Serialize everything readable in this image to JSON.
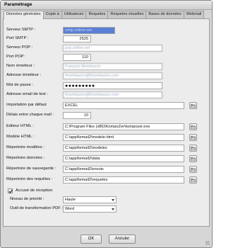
{
  "window": {
    "title": "Paramétrage"
  },
  "tabs": [
    {
      "label": "Données générales",
      "active": true
    },
    {
      "label": "Copie à"
    },
    {
      "label": "Utilisateurs"
    },
    {
      "label": "Requetes"
    },
    {
      "label": "Requetes visuelles"
    },
    {
      "label": "Bases de données"
    },
    {
      "label": "Webmail"
    }
  ],
  "form": {
    "serveur_smtp": {
      "label": "Serveur SMTP :",
      "value": "smtp.online.net"
    },
    "port_smtp": {
      "label": "Port SMTP :",
      "value": "2525"
    },
    "serveur_pop": {
      "label": "Serveur POP :",
      "value": "pop.online.net"
    },
    "port_pop": {
      "label": "Port POP :",
      "value": "110"
    },
    "nom_emetteur": {
      "label": "Nom émetteur :",
      "value": "François Mombazon"
    },
    "adresse_emetteur": {
      "label": "Adresse émetteur :",
      "value": "fmombazon@fmombazon.com"
    },
    "mot_de_passe": {
      "label": "Mot de passe :",
      "value": "●●●●●●●●●"
    },
    "adresse_test": {
      "label": "Adresse email de test :",
      "value": "fmombazon@fmombazon.com"
    },
    "importation": {
      "label": "Importation par défaut",
      "value": "EXCEL"
    },
    "delais": {
      "label": "Délais entre chaque mail :",
      "value": "10"
    },
    "editeur_html": {
      "label": "Editeur HTML :",
      "value": "C:\\Program Files (x86)\\KompoZer\\kompozer.exe"
    },
    "modele_html": {
      "label": "Modèle HTML :",
      "value": "C:\\appli\\email2\\modele.html"
    },
    "repertoire_modeles": {
      "label": "Répertoire modèles :",
      "value": "C:\\appli\\email2\\modeles"
    },
    "repertoire_donnees": {
      "label": "Répertoire données :",
      "value": "C:\\appli\\email2\\data"
    },
    "repertoire_sauvegarde": {
      "label": "Répertoire de sauvegarde :",
      "value": "C:\\appli\\email2\\envois"
    },
    "repertoire_requetes": {
      "label": "Répertoire des requêtes :",
      "value": "C:\\appli\\email2\\requetes"
    },
    "accuse": {
      "label": "Accusé de réception",
      "checked": true
    },
    "niveau_priorite": {
      "label": "Niveau de priorité :",
      "value": "Haute"
    },
    "outil_pdf": {
      "label": "Outil de transformation PDF :",
      "value": "Word"
    }
  },
  "buttons": {
    "ok": "OK",
    "annuler": "Annuler"
  }
}
